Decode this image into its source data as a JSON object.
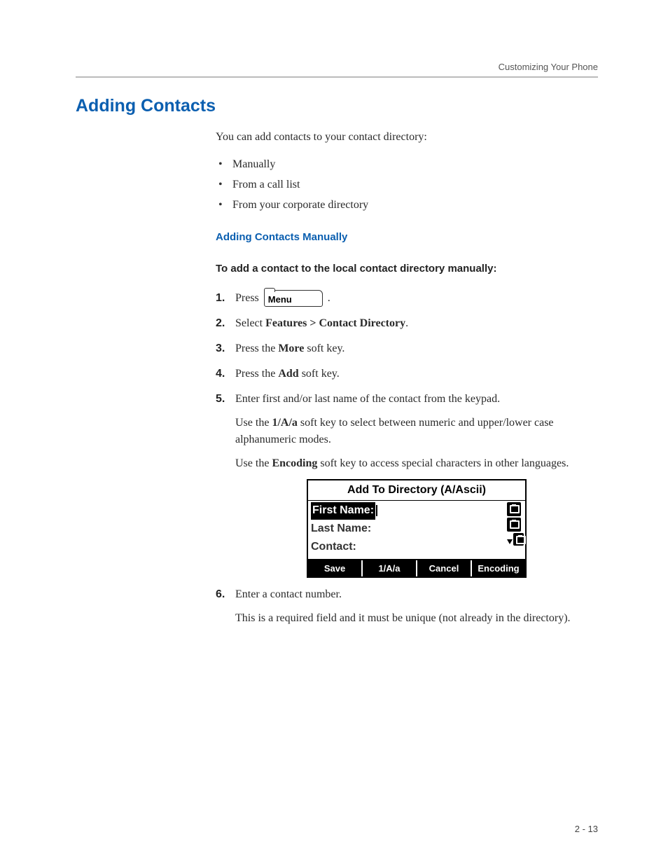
{
  "header": {
    "running": "Customizing Your Phone"
  },
  "title": "Adding Contacts",
  "intro": "You can add contacts to your contact directory:",
  "bullets": [
    "Manually",
    "From a call list",
    "From your corporate directory"
  ],
  "subhead": "Adding Contacts Manually",
  "procedure_title": "To add a contact to the local contact directory manually:",
  "menu_key_label": "Menu",
  "steps": {
    "s1_pre": "Press ",
    "s1_post": " .",
    "s2_pre": "Select ",
    "s2_bold": "Features > Contact Directory",
    "s2_post": ".",
    "s3_pre": "Press the ",
    "s3_bold": "More",
    "s3_post": " soft key.",
    "s4_pre": "Press the ",
    "s4_bold": "Add",
    "s4_post": " soft key.",
    "s5_a": "Enter first and/or last name of the contact from the keypad.",
    "s5_b_pre": "Use the ",
    "s5_b_bold": "1/A/a",
    "s5_b_post": " soft key to select between numeric and upper/lower case alphanumeric modes.",
    "s5_c_pre": "Use the ",
    "s5_c_bold": "Encoding",
    "s5_c_post": " soft key to access special characters in other languages.",
    "s6_a": "Enter a contact number.",
    "s6_b": "This is a required field and it must be unique (not already in the directory)."
  },
  "lcd": {
    "title": "Add To Directory (A/Ascii)",
    "first_label": "First Name:",
    "last_label": "Last Name:",
    "contact_label": "Contact:",
    "softkeys": [
      "Save",
      "1/A/a",
      "Cancel",
      "Encoding"
    ]
  },
  "page_number": "2 - 13"
}
